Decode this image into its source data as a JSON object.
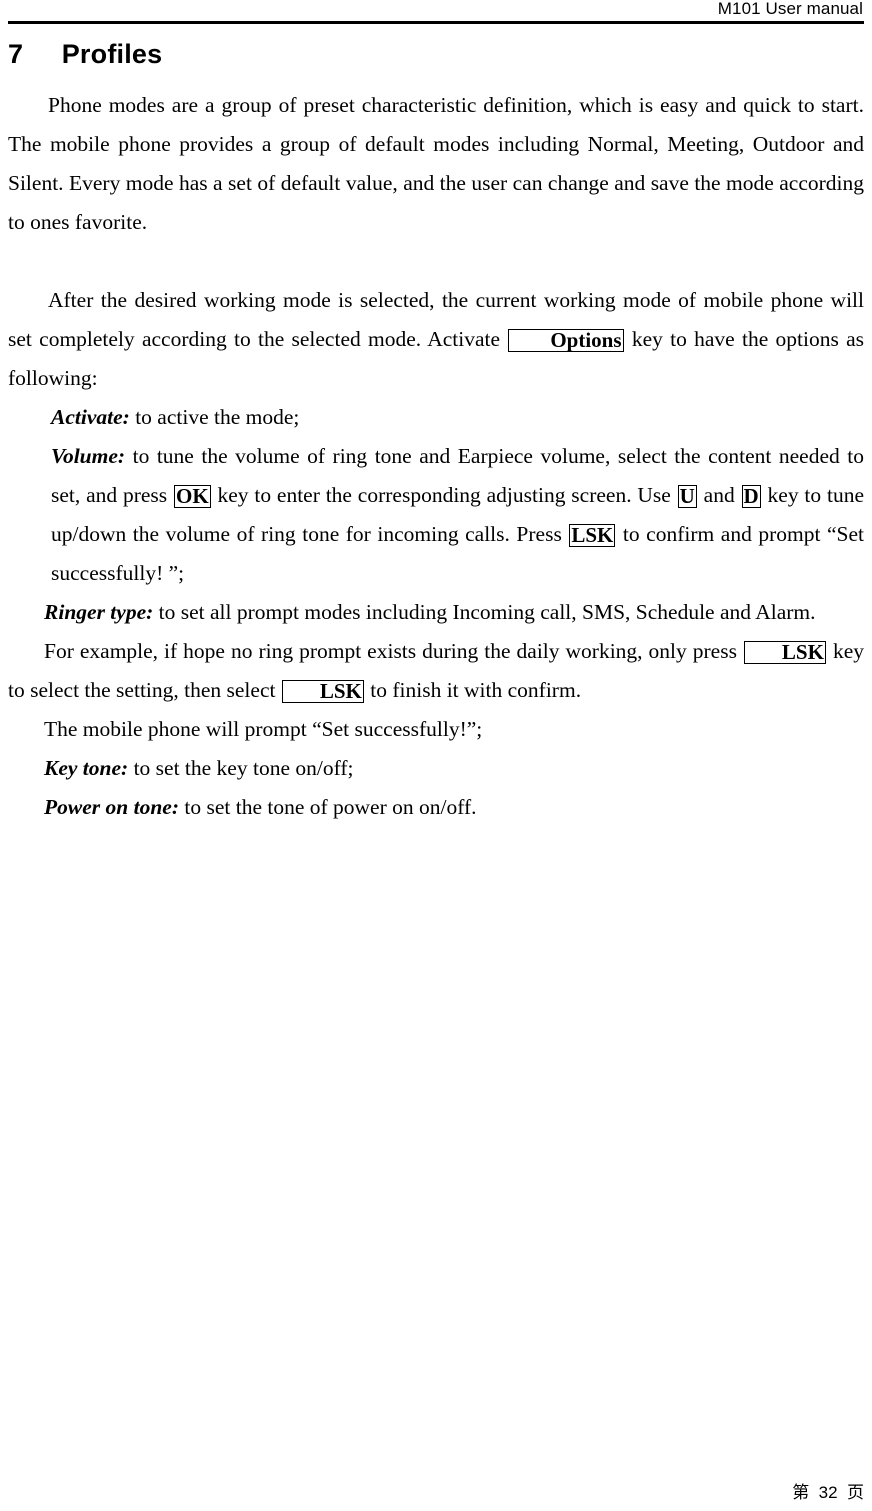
{
  "header": {
    "title": "M101 User manual"
  },
  "heading": {
    "number": "7",
    "title": "Profiles",
    "full": "7     Profiles"
  },
  "content": {
    "paragraph_1": "Phone modes are a group of preset characteristic definition, which is easy and quick to start. The mobile phone provides a group of default modes including Normal, Meeting, Outdoor and Silent. Every mode has a set of default value, and the user can change and save the mode according to ones favorite.",
    "paragraph_2_part_1": "After the desired working mode is selected, the current working mode of mobile phone will set completely according to the selected mode. Activate ",
    "paragraph_2_key": "Options",
    "paragraph_2_part_2": " key to have the options as following:",
    "activate": {
      "term": "Activate:",
      "text": " to active the mode;"
    },
    "volume": {
      "term": "Volume:",
      "text_1": " to tune the volume of ring tone and Earpiece volume, select the content needed to set, and press ",
      "key_1": "OK",
      "text_2": " key to enter the corresponding adjusting screen. Use ",
      "key_2": "U",
      "text_3": " and ",
      "key_3": "D",
      "text_4": " key to tune up/down the volume of ring tone for incoming calls. Press ",
      "key_4": "LSK",
      "text_5": " to confirm and prompt “Set successfully! ”;"
    },
    "ringer_type": {
      "term": "Ringer type:",
      "text": " to set all prompt modes including Incoming call, SMS, Schedule and Alarm."
    },
    "example": {
      "text_1": "For example, if hope no ring prompt exists during the daily working, only press ",
      "key_1": "LSK",
      "text_2": " key to select the setting, then select ",
      "key_2": "LSK",
      "text_3": " to finish it with confirm."
    },
    "prompt_line": "The mobile phone will prompt “Set successfully!”;",
    "key_tone": {
      "term": "Key tone:",
      "text": " to set the key tone on/off;"
    },
    "power_on_tone": {
      "term": "Power on tone:",
      "text": " to set the tone of power on on/off."
    }
  },
  "footer": {
    "page_label": "第  32  页"
  }
}
